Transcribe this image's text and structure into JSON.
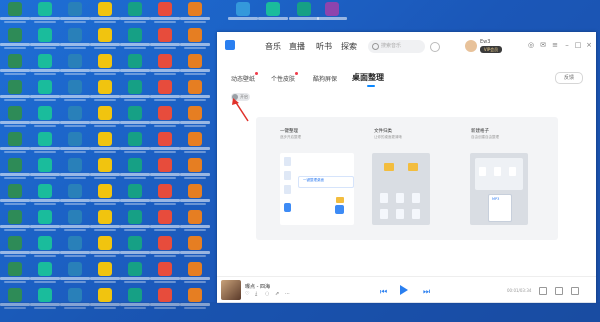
{
  "nav": {
    "music": "音乐",
    "live": "直播",
    "audiobook": "听书",
    "explore": "探索"
  },
  "search": {
    "placeholder": "搜索音乐"
  },
  "user": {
    "name": "Ew3",
    "badge": "VIP会员"
  },
  "tabs": [
    {
      "label": "动态壁纸",
      "dot": true
    },
    {
      "label": "个性皮肤",
      "dot": true
    },
    {
      "label": "酷狗屏保",
      "dot": false
    },
    {
      "label": "桌面整理",
      "dot": false
    }
  ],
  "feedback_label": "反馈",
  "toggle": {
    "label": "开启",
    "state": "off"
  },
  "features": {
    "one_click": {
      "title": "一键整理",
      "subtitle": "逐步开启整理",
      "button": "一键整理桌面"
    },
    "file_classify": {
      "title": "文件归类",
      "subtitle": "让你的桌面更清晰"
    },
    "new_box": {
      "title": "新建格子",
      "subtitle": "自由创建自由整理",
      "mp3": "MP3"
    }
  },
  "player": {
    "song": "曝点 - 四海",
    "time": "00:01/03:34"
  },
  "colors": {
    "accent": "#2a7ff0",
    "desktop_bg": "#1e6fd6",
    "badge_dot": "#f03c4a"
  }
}
